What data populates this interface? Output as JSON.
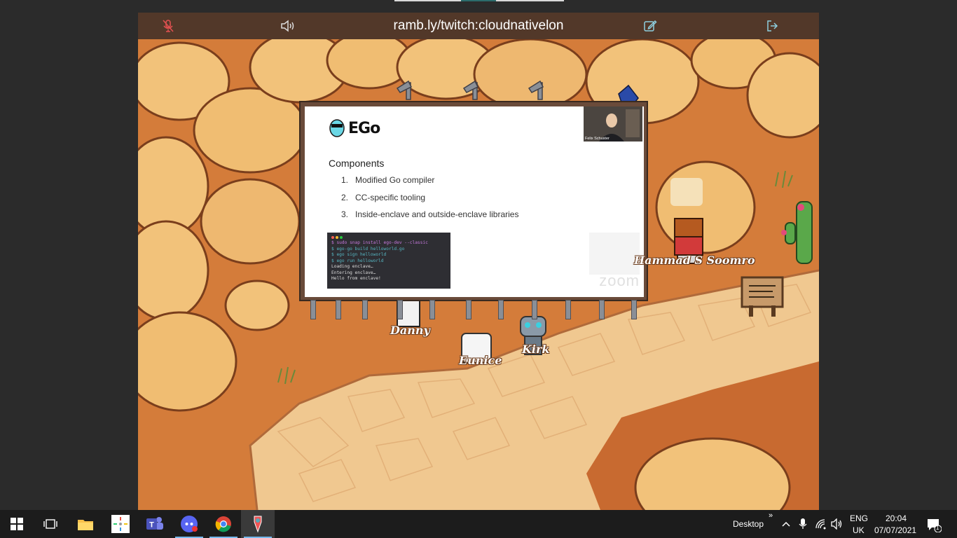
{
  "window": {
    "title": "ramb.ly/twitch:cloudnativelon"
  },
  "toolbar": {
    "mic_icon": "mic-off-icon",
    "volume_icon": "speaker-icon",
    "edit_icon": "edit-icon",
    "exit_icon": "exit-icon"
  },
  "slide": {
    "logo_text": "EGo",
    "heading": "Components",
    "items": [
      {
        "num": "1.",
        "text": "Modified Go compiler"
      },
      {
        "num": "2.",
        "text": "CC-specific tooling"
      },
      {
        "num": "3.",
        "text": "Inside-enclave and outside-enclave libraries"
      }
    ],
    "terminal_lines": [
      {
        "text": "$ sudo snap install ego-dev --classic",
        "color": "#c678dd"
      },
      {
        "text": "$ ego-go build helloworld.go",
        "color": "#56b6c2"
      },
      {
        "text": "$ ego sign helloworld",
        "color": "#56b6c2"
      },
      {
        "text": "$ ego run helloworld",
        "color": "#56b6c2"
      },
      {
        "text": "Loading enclave…",
        "color": "#dddddd"
      },
      {
        "text": "Entering enclave…",
        "color": "#dddddd"
      },
      {
        "text": "Hello from enclave!",
        "color": "#dddddd"
      }
    ],
    "video_name": "Felix Schuster",
    "watermark": "zoom"
  },
  "avatars": [
    {
      "name": "Danny"
    },
    {
      "name": "Eunice"
    },
    {
      "name": "Kirk"
    },
    {
      "name": "Hammad S Soomro"
    }
  ],
  "taskbar": {
    "apps": [
      "windows-start-icon",
      "task-view-icon",
      "file-explorer-icon",
      "photos-icon",
      "teams-icon",
      "discord-icon",
      "chrome-icon",
      "app-icon"
    ],
    "desktop_label": "Desktop",
    "desktop_chevron": "»",
    "lang_line1": "ENG",
    "lang_line2": "UK",
    "time": "20:04",
    "date": "07/07/2021",
    "notification_count": "1"
  },
  "colors": {
    "sand": "#d47c3a",
    "path": "#f0c890",
    "rock": "#f2c27a",
    "taskbar": "#1c1c1c",
    "accent": "#76b9ed"
  }
}
